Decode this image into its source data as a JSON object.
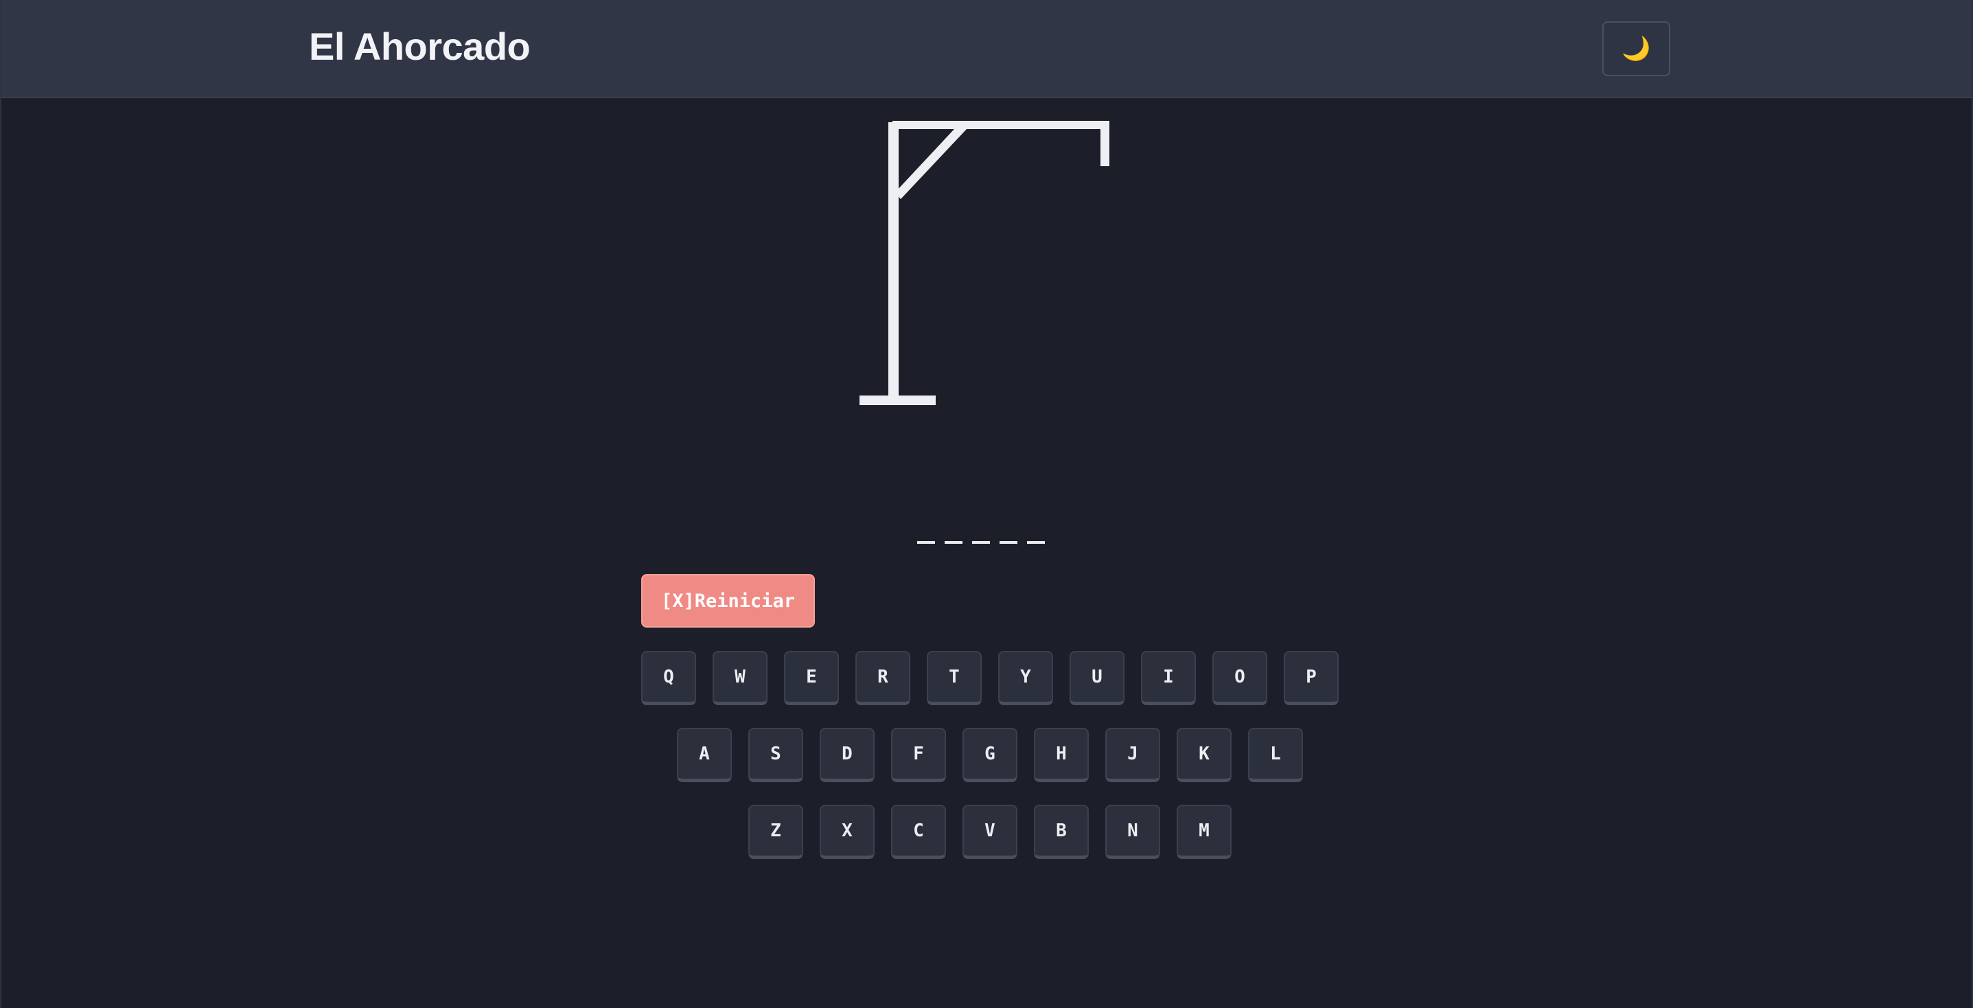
{
  "header": {
    "title": "El Ahorcado",
    "theme_toggle_icon": "moon-icon",
    "theme_toggle_glyph": "🌙"
  },
  "game": {
    "word_slots": [
      "_",
      "_",
      "_",
      "_",
      "_"
    ],
    "reset_label": "[X]Reiniciar"
  },
  "keyboard": {
    "row1": [
      "Q",
      "W",
      "E",
      "R",
      "T",
      "Y",
      "U",
      "I",
      "O",
      "P"
    ],
    "row2": [
      "A",
      "S",
      "D",
      "F",
      "G",
      "H",
      "J",
      "K",
      "L"
    ],
    "row3": [
      "Z",
      "X",
      "C",
      "V",
      "B",
      "N",
      "M"
    ]
  },
  "colors": {
    "background": "#1c1f29",
    "header": "#313647",
    "reset_button": "#f08a85",
    "gallows": "#eeeff2"
  }
}
